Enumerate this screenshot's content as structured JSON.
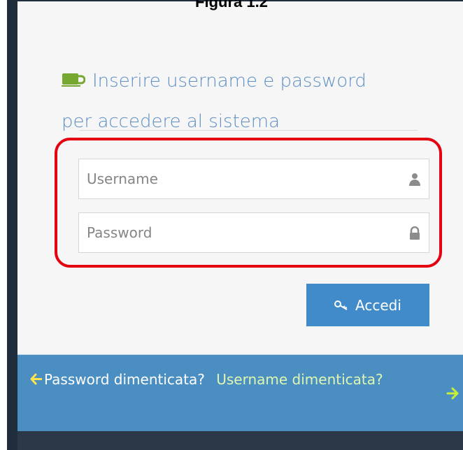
{
  "figure": {
    "caption": "Figura 1.2"
  },
  "login": {
    "heading_line1": "Inserire username e password",
    "heading_line2": "per accedere al sistema",
    "username_placeholder": "Username",
    "password_placeholder": "Password",
    "submit_label": "Accedi"
  },
  "footer": {
    "forgot_password_label": "Password dimenticata?",
    "forgot_username_label": "Username dimenticata?"
  },
  "icons": {
    "heading": "coffee-icon",
    "username": "user-icon",
    "password": "lock-icon",
    "submit": "key-icon",
    "back": "arrow-left-icon",
    "forward": "arrow-right-icon"
  },
  "colors": {
    "accent": "#428bca",
    "heading": "#5d8fc4",
    "icon_green": "#76a72f",
    "highlight": "#e4000f",
    "footer": "#4a8ec2"
  }
}
